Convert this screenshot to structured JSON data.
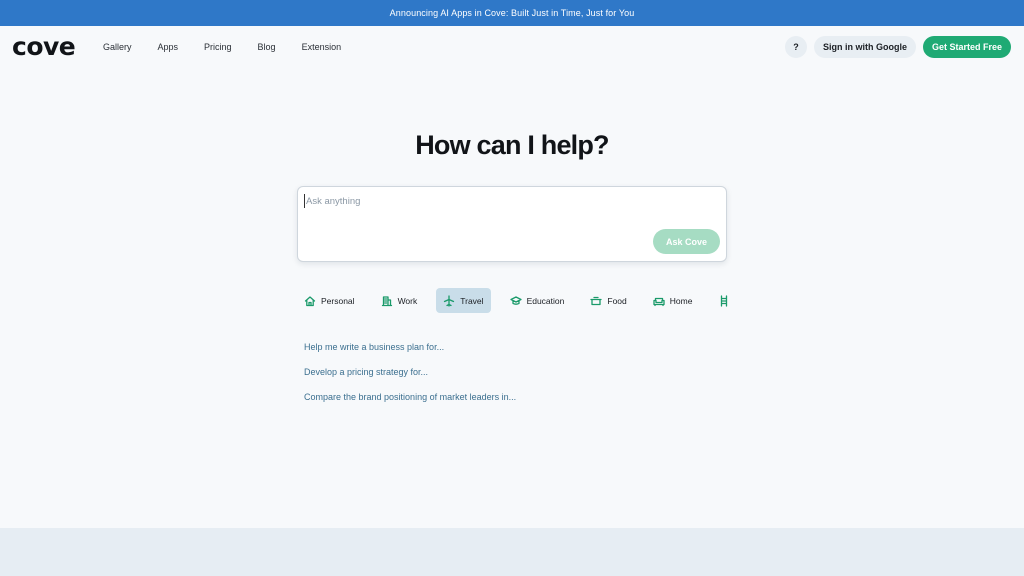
{
  "announcement": "Announcing AI Apps in Cove: Built Just in Time, Just for You",
  "brand": {
    "logo": "cove",
    "accent": "#1faa74",
    "banner_color": "#2f78c8"
  },
  "nav": {
    "links": [
      "Gallery",
      "Apps",
      "Pricing",
      "Blog",
      "Extension"
    ],
    "help_label": "?",
    "signin_label": "Sign in with Google",
    "cta_label": "Get Started Free"
  },
  "main": {
    "headline": "How can I help?",
    "ask": {
      "placeholder": "Ask anything",
      "value": "",
      "button_label": "Ask Cove"
    },
    "categories": [
      {
        "label": "Personal",
        "icon": "home-outline-icon"
      },
      {
        "label": "Work",
        "icon": "building-icon"
      },
      {
        "label": "Travel",
        "icon": "airplane-icon",
        "selected": true
      },
      {
        "label": "Education",
        "icon": "graduation-cap-icon"
      },
      {
        "label": "Food",
        "icon": "pot-icon"
      },
      {
        "label": "Home",
        "icon": "sofa-icon"
      }
    ],
    "more_icon": "ladder-icon",
    "suggestions": [
      "Help me write a business plan for...",
      "Develop a pricing strategy for...",
      "Compare the brand positioning of market leaders in..."
    ]
  }
}
